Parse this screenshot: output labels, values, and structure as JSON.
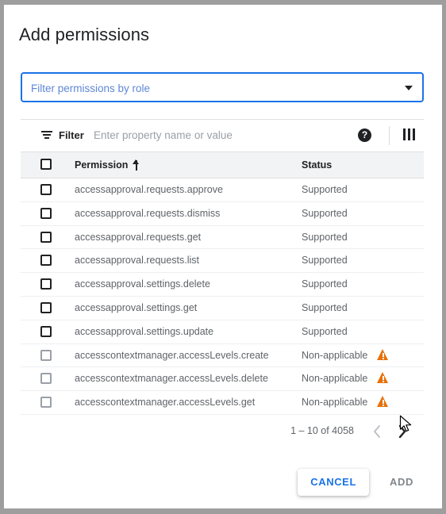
{
  "dialog": {
    "title": "Add permissions"
  },
  "role_filter": {
    "placeholder": "Filter permissions by role",
    "value": "",
    "arrow_icon": "chevron-down-icon"
  },
  "toolbar": {
    "filter_icon": "filter-icon",
    "filter_label": "Filter",
    "input_placeholder": "Enter property name or value",
    "input_value": "",
    "help_icon": "help-icon",
    "help_glyph": "?",
    "columns_icon": "columns-icon"
  },
  "table": {
    "columns": [
      {
        "key": "permission",
        "label": "Permission",
        "sorted": true,
        "sort_icon": "sort-ascending-icon"
      },
      {
        "key": "status",
        "label": "Status",
        "sorted": false
      }
    ],
    "rows": [
      {
        "permission": "accessapproval.requests.approve",
        "status": "Supported",
        "warning": false,
        "checkbox_enabled": true
      },
      {
        "permission": "accessapproval.requests.dismiss",
        "status": "Supported",
        "warning": false,
        "checkbox_enabled": true
      },
      {
        "permission": "accessapproval.requests.get",
        "status": "Supported",
        "warning": false,
        "checkbox_enabled": true
      },
      {
        "permission": "accessapproval.requests.list",
        "status": "Supported",
        "warning": false,
        "checkbox_enabled": true
      },
      {
        "permission": "accessapproval.settings.delete",
        "status": "Supported",
        "warning": false,
        "checkbox_enabled": true
      },
      {
        "permission": "accessapproval.settings.get",
        "status": "Supported",
        "warning": false,
        "checkbox_enabled": true
      },
      {
        "permission": "accessapproval.settings.update",
        "status": "Supported",
        "warning": false,
        "checkbox_enabled": true
      },
      {
        "permission": "accesscontextmanager.accessLevels.create",
        "status": "Non-applicable",
        "warning": true,
        "checkbox_enabled": false
      },
      {
        "permission": "accesscontextmanager.accessLevels.delete",
        "status": "Non-applicable",
        "warning": true,
        "checkbox_enabled": false
      },
      {
        "permission": "accesscontextmanager.accessLevels.get",
        "status": "Non-applicable",
        "warning": true,
        "checkbox_enabled": false
      }
    ]
  },
  "pagination": {
    "range_text": "1 – 10 of 4058",
    "prev_icon": "chevron-left-icon",
    "next_icon": "chevron-right-icon",
    "prev_enabled": false,
    "next_enabled": true
  },
  "footer": {
    "cancel_label": "CANCEL",
    "add_label": "ADD",
    "add_enabled": false
  },
  "colors": {
    "accent": "#1a73e8",
    "warning": "#e8710a",
    "text_primary": "#202124",
    "text_secondary": "#5f6368",
    "header_bg": "#f1f3f4",
    "backdrop": "#9e9e9e"
  },
  "cursor": {
    "icon": "mouse-pointer-icon"
  }
}
